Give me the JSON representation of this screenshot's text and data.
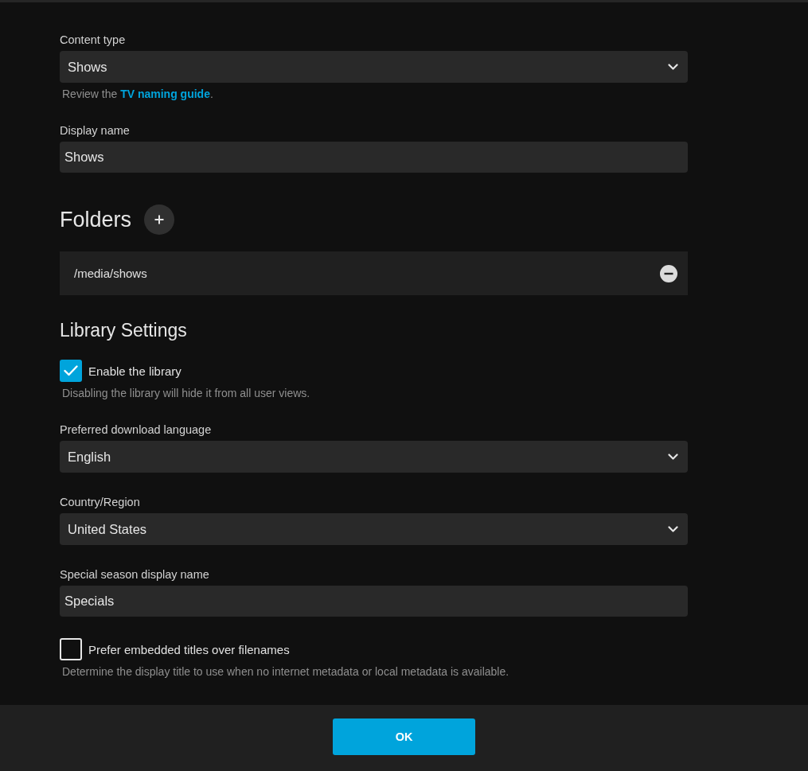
{
  "fields": [
    {
      "kind": "select",
      "label": "Content type",
      "value": "Shows",
      "help": {
        "before": "Review the ",
        "link": "TV naming guide",
        "after": "."
      }
    },
    {
      "kind": "input",
      "label": "Display name",
      "value": "Shows"
    }
  ],
  "folders": {
    "title": "Folders",
    "items": [
      "/media/shows"
    ]
  },
  "library_settings": {
    "title": "Library Settings",
    "items": [
      {
        "kind": "checkbox",
        "label": "Enable the library",
        "checked": true,
        "help": "Disabling the library will hide it from all user views."
      },
      {
        "kind": "select",
        "label": "Preferred download language",
        "value": "English"
      },
      {
        "kind": "select",
        "label": "Country/Region",
        "value": "United States"
      },
      {
        "kind": "input",
        "label": "Special season display name",
        "value": "Specials"
      },
      {
        "kind": "checkbox",
        "label": "Prefer embedded titles over filenames",
        "checked": false,
        "help": "Determine the display title to use when no internet metadata or local metadata is available."
      }
    ]
  },
  "footer": {
    "button": "OK"
  }
}
